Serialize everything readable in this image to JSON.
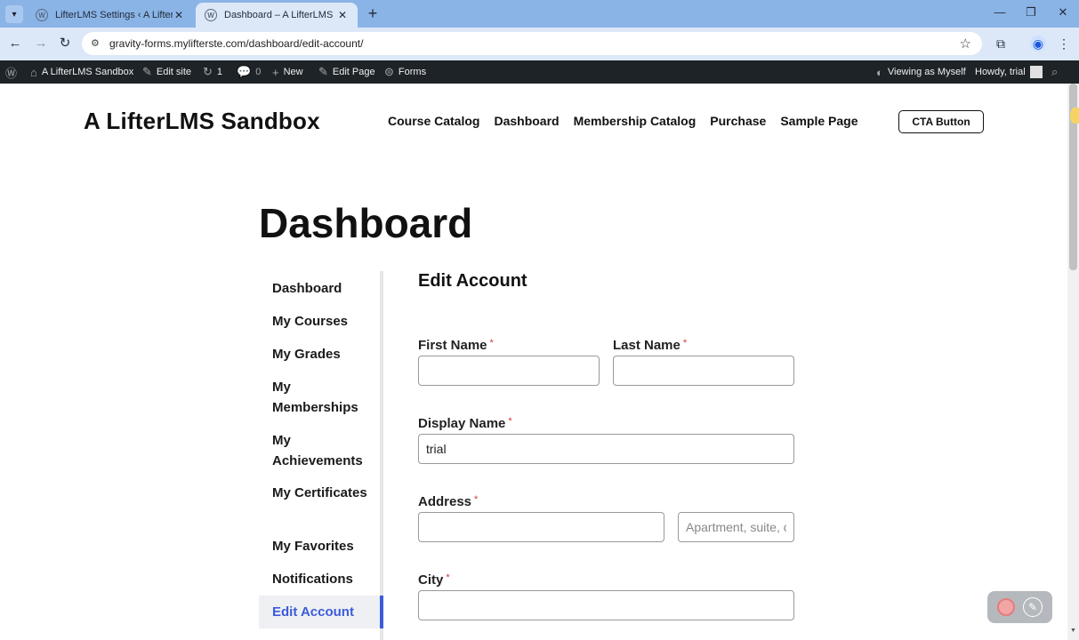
{
  "browser": {
    "tabs": [
      {
        "title": "LifterLMS Settings ‹ A LifterLMS",
        "active": false
      },
      {
        "title": "Dashboard – A LifterLMS Sandb",
        "active": true
      }
    ],
    "url": "gravity-forms.mylifterste.com/dashboard/edit-account/"
  },
  "adminbar": {
    "site_name": "A LifterLMS Sandbox",
    "edit_site": "Edit site",
    "updates_count": "1",
    "comments_count": "0",
    "new": "New",
    "edit_page": "Edit Page",
    "forms": "Forms",
    "viewing_as": "Viewing as Myself",
    "howdy": "Howdy, trial"
  },
  "header": {
    "site_title": "A LifterLMS Sandbox",
    "nav": [
      "Course Catalog",
      "Dashboard",
      "Membership Catalog",
      "Purchase",
      "Sample Page"
    ],
    "cta": "CTA Button"
  },
  "page": {
    "title": "Dashboard",
    "sidebar": [
      "Dashboard",
      "My Courses",
      "My Grades",
      "My Memberships",
      "My Achievements",
      "My Certificates",
      "My Favorites",
      "Notifications",
      "Edit Account"
    ],
    "active_item": "Edit Account"
  },
  "form": {
    "section_title": "Edit Account",
    "required_mark": "*",
    "first_name_label": "First Name",
    "last_name_label": "Last Name",
    "display_name_label": "Display Name",
    "display_name_value": "trial",
    "address_label": "Address",
    "address2_placeholder": "Apartment, suite, or unit",
    "city_label": "City"
  }
}
